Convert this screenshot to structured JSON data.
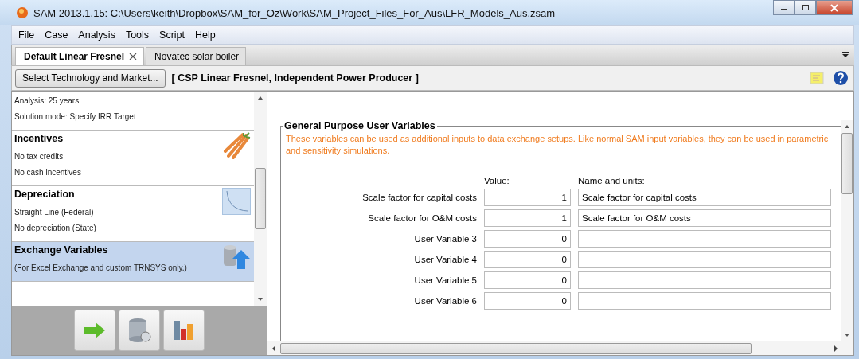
{
  "window": {
    "title": "SAM 2013.1.15: C:\\Users\\keith\\Dropbox\\SAM_for_Oz\\Work\\SAM_Project_Files_For_Aus\\LFR_Models_Aus.zsam"
  },
  "menu": [
    "File",
    "Case",
    "Analysis",
    "Tools",
    "Script",
    "Help"
  ],
  "tabs": [
    {
      "label": "Default Linear Fresnel",
      "selected": true
    },
    {
      "label": "Novatec solar boiler",
      "selected": false
    }
  ],
  "toolbar": {
    "button": "Select Technology and Market...",
    "configuration": "[ CSP Linear Fresnel, Independent Power Producer ]"
  },
  "sidebar": {
    "items": [
      {
        "lines": [
          "Analysis: 25 years",
          "Solution mode: Specify IRR Target"
        ],
        "selected": false
      },
      {
        "title": "Incentives",
        "lines": [
          "No tax credits",
          "No cash incentives"
        ],
        "selected": false
      },
      {
        "title": "Depreciation",
        "lines": [
          "Straight Line (Federal)",
          "No depreciation (State)"
        ],
        "selected": false
      },
      {
        "title": "Exchange Variables",
        "lines": [
          "(For Excel Exchange and custom TRNSYS only.)"
        ],
        "selected": true
      }
    ]
  },
  "group": {
    "title": "General Purpose User Variables",
    "note": "These variables can be used as additional inputs to data exchange setups.  Like normal SAM input variables, they can be used in parametric and sensitivity simulations.",
    "value_header": "Value:",
    "name_header": "Name and units:",
    "rows": [
      {
        "label": "Scale factor for capital costs",
        "value": "1",
        "name": "Scale factor for capital costs"
      },
      {
        "label": "Scale factor for O&M costs",
        "value": "1",
        "name": "Scale factor for O&M costs"
      },
      {
        "label": "User Variable 3",
        "value": "0",
        "name": ""
      },
      {
        "label": "User Variable 4",
        "value": "0",
        "name": ""
      },
      {
        "label": "User Variable 5",
        "value": "0",
        "name": ""
      },
      {
        "label": "User Variable 6",
        "value": "0",
        "name": ""
      }
    ]
  }
}
